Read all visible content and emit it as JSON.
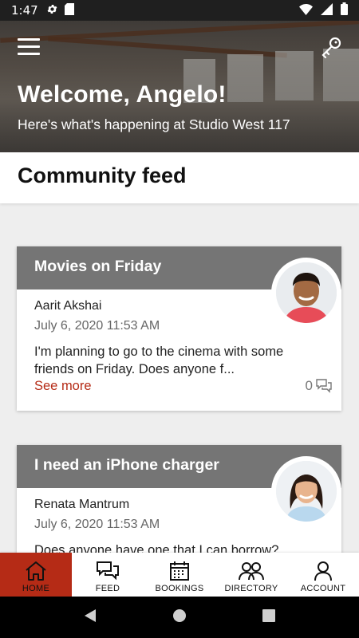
{
  "status_bar": {
    "time": "1:47"
  },
  "hero": {
    "title": "Welcome, Angelo!",
    "subtitle": "Here's what's happening at Studio West 117"
  },
  "section": {
    "title": "Community feed"
  },
  "feed": {
    "posts": [
      {
        "title": "Movies on Friday",
        "author": "Aarit Akshai",
        "timestamp": "July 6, 2020 11:53 AM",
        "text": "I'm planning to go to the cinema with some friends on Friday. Does anyone f...",
        "see_more": "See more",
        "comment_count": "0"
      },
      {
        "title": "I need an iPhone charger",
        "author": "Renata Mantrum",
        "timestamp": "July 6, 2020 11:53 AM",
        "text": "Does anyone have one that I can borrow?",
        "see_more": "",
        "comment_count": ""
      }
    ]
  },
  "bottom_nav": {
    "items": [
      {
        "label": "HOME",
        "icon": "home-icon",
        "active": true
      },
      {
        "label": "FEED",
        "icon": "feed-icon",
        "active": false
      },
      {
        "label": "BOOKINGS",
        "icon": "calendar-icon",
        "active": false
      },
      {
        "label": "DIRECTORY",
        "icon": "people-icon",
        "active": false
      },
      {
        "label": "ACCOUNT",
        "icon": "person-icon",
        "active": false
      }
    ]
  },
  "colors": {
    "accent": "#b52b16",
    "card_header": "#757575",
    "status_bar": "#1f1f1f"
  }
}
